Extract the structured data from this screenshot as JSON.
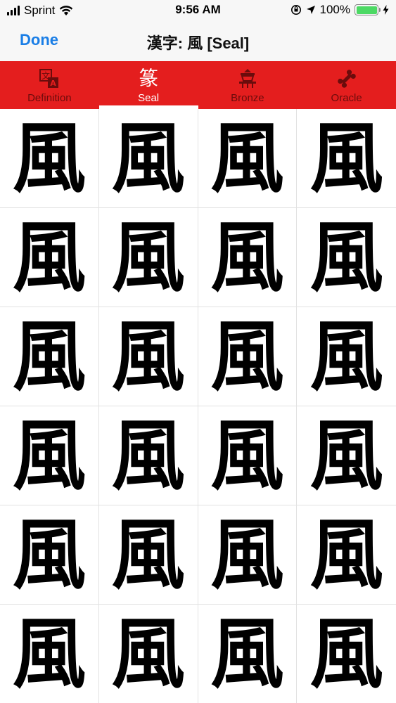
{
  "status_bar": {
    "carrier": "Sprint",
    "time": "9:56 AM",
    "battery_percent": "100%",
    "battery_color": "#4cd964"
  },
  "nav": {
    "done_label": "Done",
    "title": "漢字: 風 [Seal]"
  },
  "colors": {
    "accent": "#1a7ee6",
    "tab_bar": "#e41e1e"
  },
  "tabs": [
    {
      "label": "Definition",
      "icon": "translate-icon",
      "active": false
    },
    {
      "label": "Seal",
      "icon": "seal-script-icon",
      "active": true
    },
    {
      "label": "Bronze",
      "icon": "bronze-vessel-icon",
      "active": false
    },
    {
      "label": "Oracle",
      "icon": "bone-icon",
      "active": false
    }
  ],
  "glyphs": [
    "風",
    "風",
    "風",
    "風",
    "風",
    "風",
    "風",
    "風",
    "風",
    "風",
    "風",
    "風",
    "風",
    "風",
    "風",
    "風",
    "風",
    "風",
    "風",
    "風",
    "風",
    "風",
    "風",
    "風"
  ]
}
